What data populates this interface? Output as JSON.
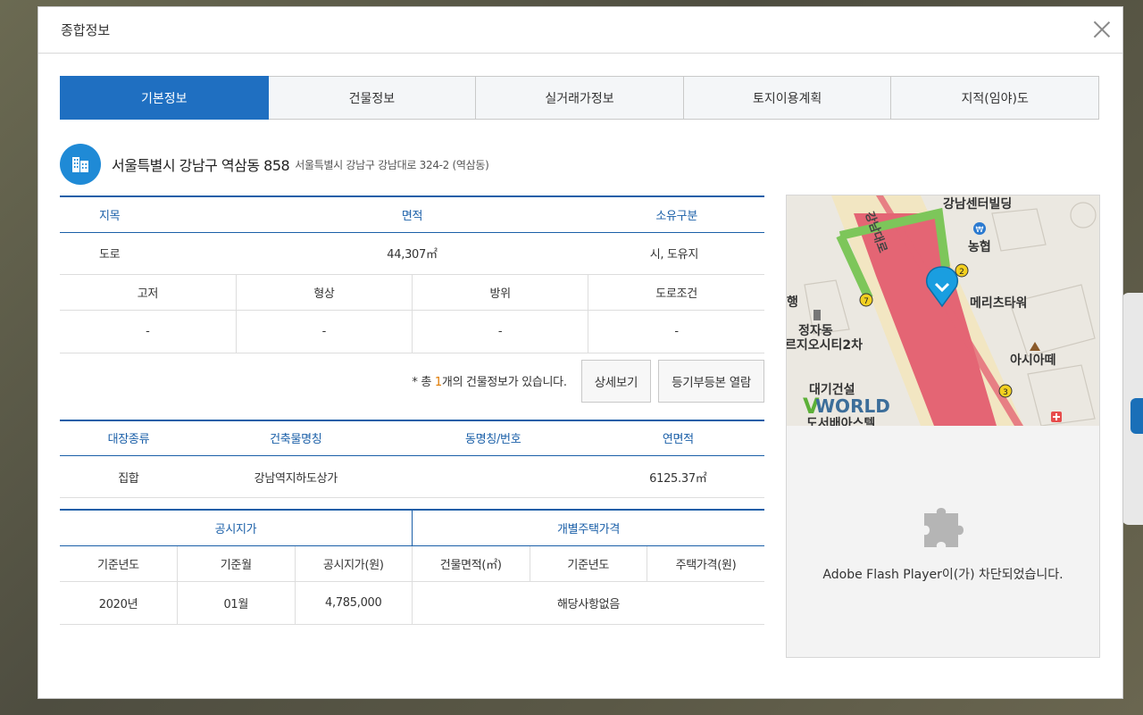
{
  "modal": {
    "title": "종합정보"
  },
  "tabs": [
    {
      "label": "기본정보",
      "active": true
    },
    {
      "label": "건물정보",
      "active": false
    },
    {
      "label": "실거래가정보",
      "active": false
    },
    {
      "label": "토지이용계획",
      "active": false
    },
    {
      "label": "지적(임야)도",
      "active": false
    }
  ],
  "address": {
    "main": "서울특별시 강남구 역삼동 858",
    "road": "서울특별시 강남구 강남대로 324-2 (역삼동)"
  },
  "land_table": {
    "headers": [
      "지목",
      "면적",
      "소유구분"
    ],
    "values": [
      "도로",
      "44,307㎡",
      "시, 도유지"
    ],
    "sub_headers": [
      "고저",
      "형상",
      "방위",
      "도로조건"
    ],
    "sub_values": [
      "-",
      "-",
      "-",
      "-"
    ]
  },
  "building_notice": {
    "prefix": "* 총 ",
    "count": "1",
    "suffix": "개의 건물정보가 있습니다.",
    "detail_button": "상세보기",
    "registry_button": "등기부등본 열람"
  },
  "building_table": {
    "headers": [
      "대장종류",
      "건축물명칭",
      "동명칭/번호",
      "연면적"
    ],
    "values": [
      "집합",
      "강남역지하도상가",
      "",
      "6125.37㎡"
    ]
  },
  "price_table": {
    "group_left": "공시지가",
    "group_right": "개별주택가격",
    "headers": [
      "기준년도",
      "기준월",
      "공시지가(원)",
      "건물면적(㎡)",
      "기준년도",
      "주택가격(원)"
    ],
    "values": [
      "2020년",
      "01월",
      "4,785,000"
    ],
    "none": "해당사항없음"
  },
  "map": {
    "labels": {
      "building1": "강남센터빌딩",
      "bank": "농협",
      "road": "강남대로",
      "tower": "메리츠타워",
      "hang": "행",
      "jeongja": "정자동",
      "city": "르지오시티2차",
      "asia": "아시아떼",
      "daegi": "대기건설",
      "bottom": "도서배아스텔"
    },
    "exits": [
      "7",
      "2",
      "3"
    ],
    "watermark": "WORLD",
    "watermark_v": "V"
  },
  "flash": {
    "message": "Adobe Flash Player이(가) 차단되었습니다."
  },
  "colors": {
    "accent": "#1f6fc1",
    "header_text": "#1a5fa8",
    "count": "#e07a00"
  }
}
